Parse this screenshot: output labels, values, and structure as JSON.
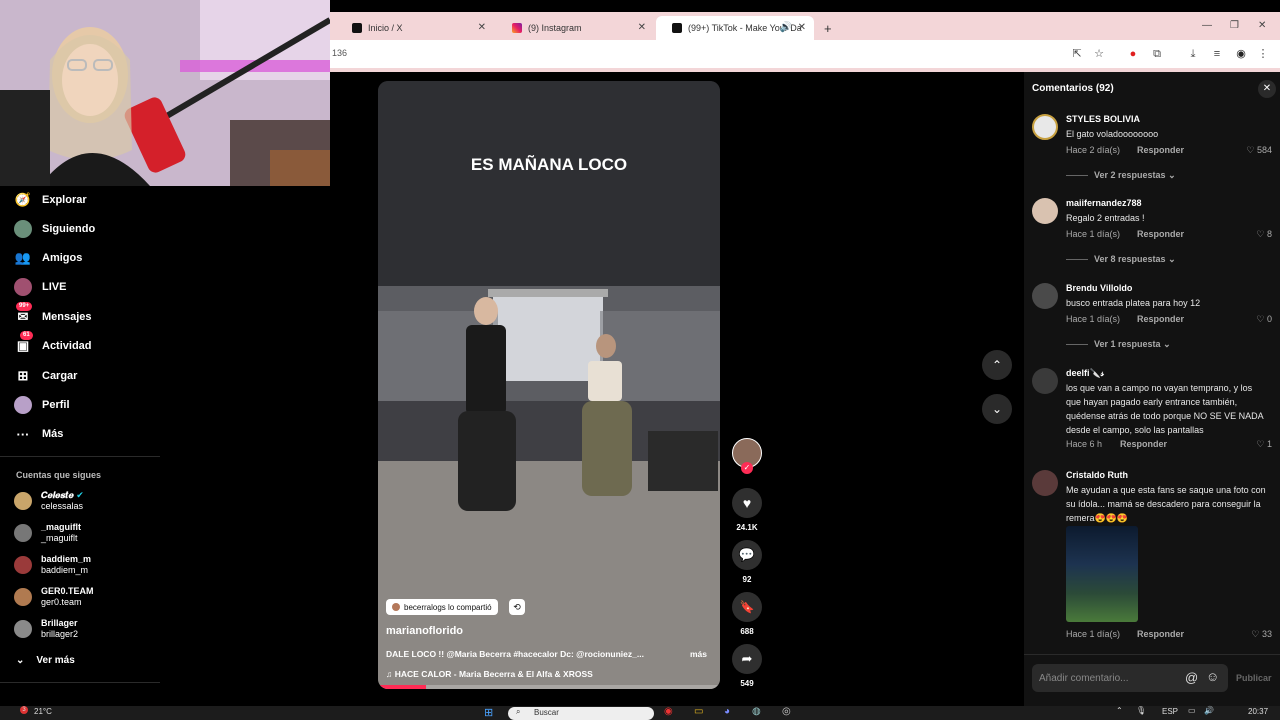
{
  "browser": {
    "tabs": [
      {
        "label": "Inicio / X"
      },
      {
        "label": "(9) Instagram"
      },
      {
        "label": "(99+) TikTok - Make Your Da"
      }
    ],
    "new_tab": "+",
    "address_fragment": "136"
  },
  "sidebar": {
    "nav": [
      {
        "label": "Explorar",
        "icon": "compass-icon"
      },
      {
        "label": "Siguiendo",
        "icon": "following-avatar-icon"
      },
      {
        "label": "Amigos",
        "icon": "friends-icon"
      },
      {
        "label": "LIVE",
        "icon": "live-icon"
      },
      {
        "label": "Mensajes",
        "icon": "messages-icon",
        "badge": "99+"
      },
      {
        "label": "Actividad",
        "icon": "activity-icon",
        "badge": "61"
      },
      {
        "label": "Cargar",
        "icon": "upload-icon"
      },
      {
        "label": "Perfil",
        "icon": "profile-icon"
      },
      {
        "label": "Más",
        "icon": "more-icon"
      }
    ],
    "following_title": "Cuentas que sigues",
    "following": [
      {
        "name": "𝑪𝒆𝒍𝒆𝒔𝒕𝒆",
        "handle": "celessalas",
        "verified": true
      },
      {
        "name": "_maguiflt",
        "handle": "_maguiflt"
      },
      {
        "name": "baddiem_m",
        "handle": "baddiem_m"
      },
      {
        "name": "GER0.TEAM",
        "handle": "ger0.team"
      },
      {
        "name": "Brillager",
        "handle": "brillager2"
      }
    ],
    "see_more": "Ver más"
  },
  "video": {
    "overlay_text": "ES MAÑANA LOCO",
    "shared_by": "becerralogs lo compartió",
    "author": "marianoflorido",
    "caption": "DALE LOCO !! @Maria Becerra #hacecalor Dc: @rocionuniez_...",
    "caption_more": "más",
    "music": "HACE CALOR - Maria Becerra & El Alfa & XROSS",
    "likes": "24.1K",
    "comments": "92",
    "saves": "688",
    "shares": "549",
    "progress": 0.14
  },
  "comments_panel": {
    "title": "Comentarios (92)",
    "items": [
      {
        "user": "STYLES BOLIVIA",
        "text": "El gato voladoooooooo",
        "time": "Hace 2 día(s)",
        "reply": "Responder",
        "likes": "584",
        "more": "Ver 2 respuestas"
      },
      {
        "user": "maiifernandez788",
        "text": "Regalo 2 entradas !",
        "time": "Hace 1 día(s)",
        "reply": "Responder",
        "likes": "8",
        "more": "Ver 8 respuestas"
      },
      {
        "user": "Brendu Villoldo",
        "text": "busco entrada platea para hoy 12",
        "time": "Hace 1 día(s)",
        "reply": "Responder",
        "likes": "0",
        "more": "Ver 1 respuesta"
      },
      {
        "user": "deelfi🔪𝓈",
        "text": "los que van a campo no vayan temprano, y los que hayan pagado early entrance también, quédense atrás de todo porque NO SE VE NADA desde el campo, solo las pantallas",
        "time": "Hace 6 h",
        "reply": "Responder",
        "likes": "1"
      },
      {
        "user": "Cristaldo Ruth",
        "text": "Me ayudan a que esta fans se saque una foto con su ídola... mamá se descadero para conseguir la remera😍😍😍",
        "time": "Hace 1 día(s)",
        "reply": "Responder",
        "likes": "33"
      }
    ],
    "input_placeholder": "Añadir comentario...",
    "post_label": "Publicar"
  },
  "taskbar": {
    "weather": "21°C",
    "search": "Buscar",
    "lang": "ESP",
    "time": "20:37",
    "notif_count": "3"
  },
  "colors": {
    "accent": "#fe2c55",
    "tab_bg": "#f3d6d8"
  }
}
